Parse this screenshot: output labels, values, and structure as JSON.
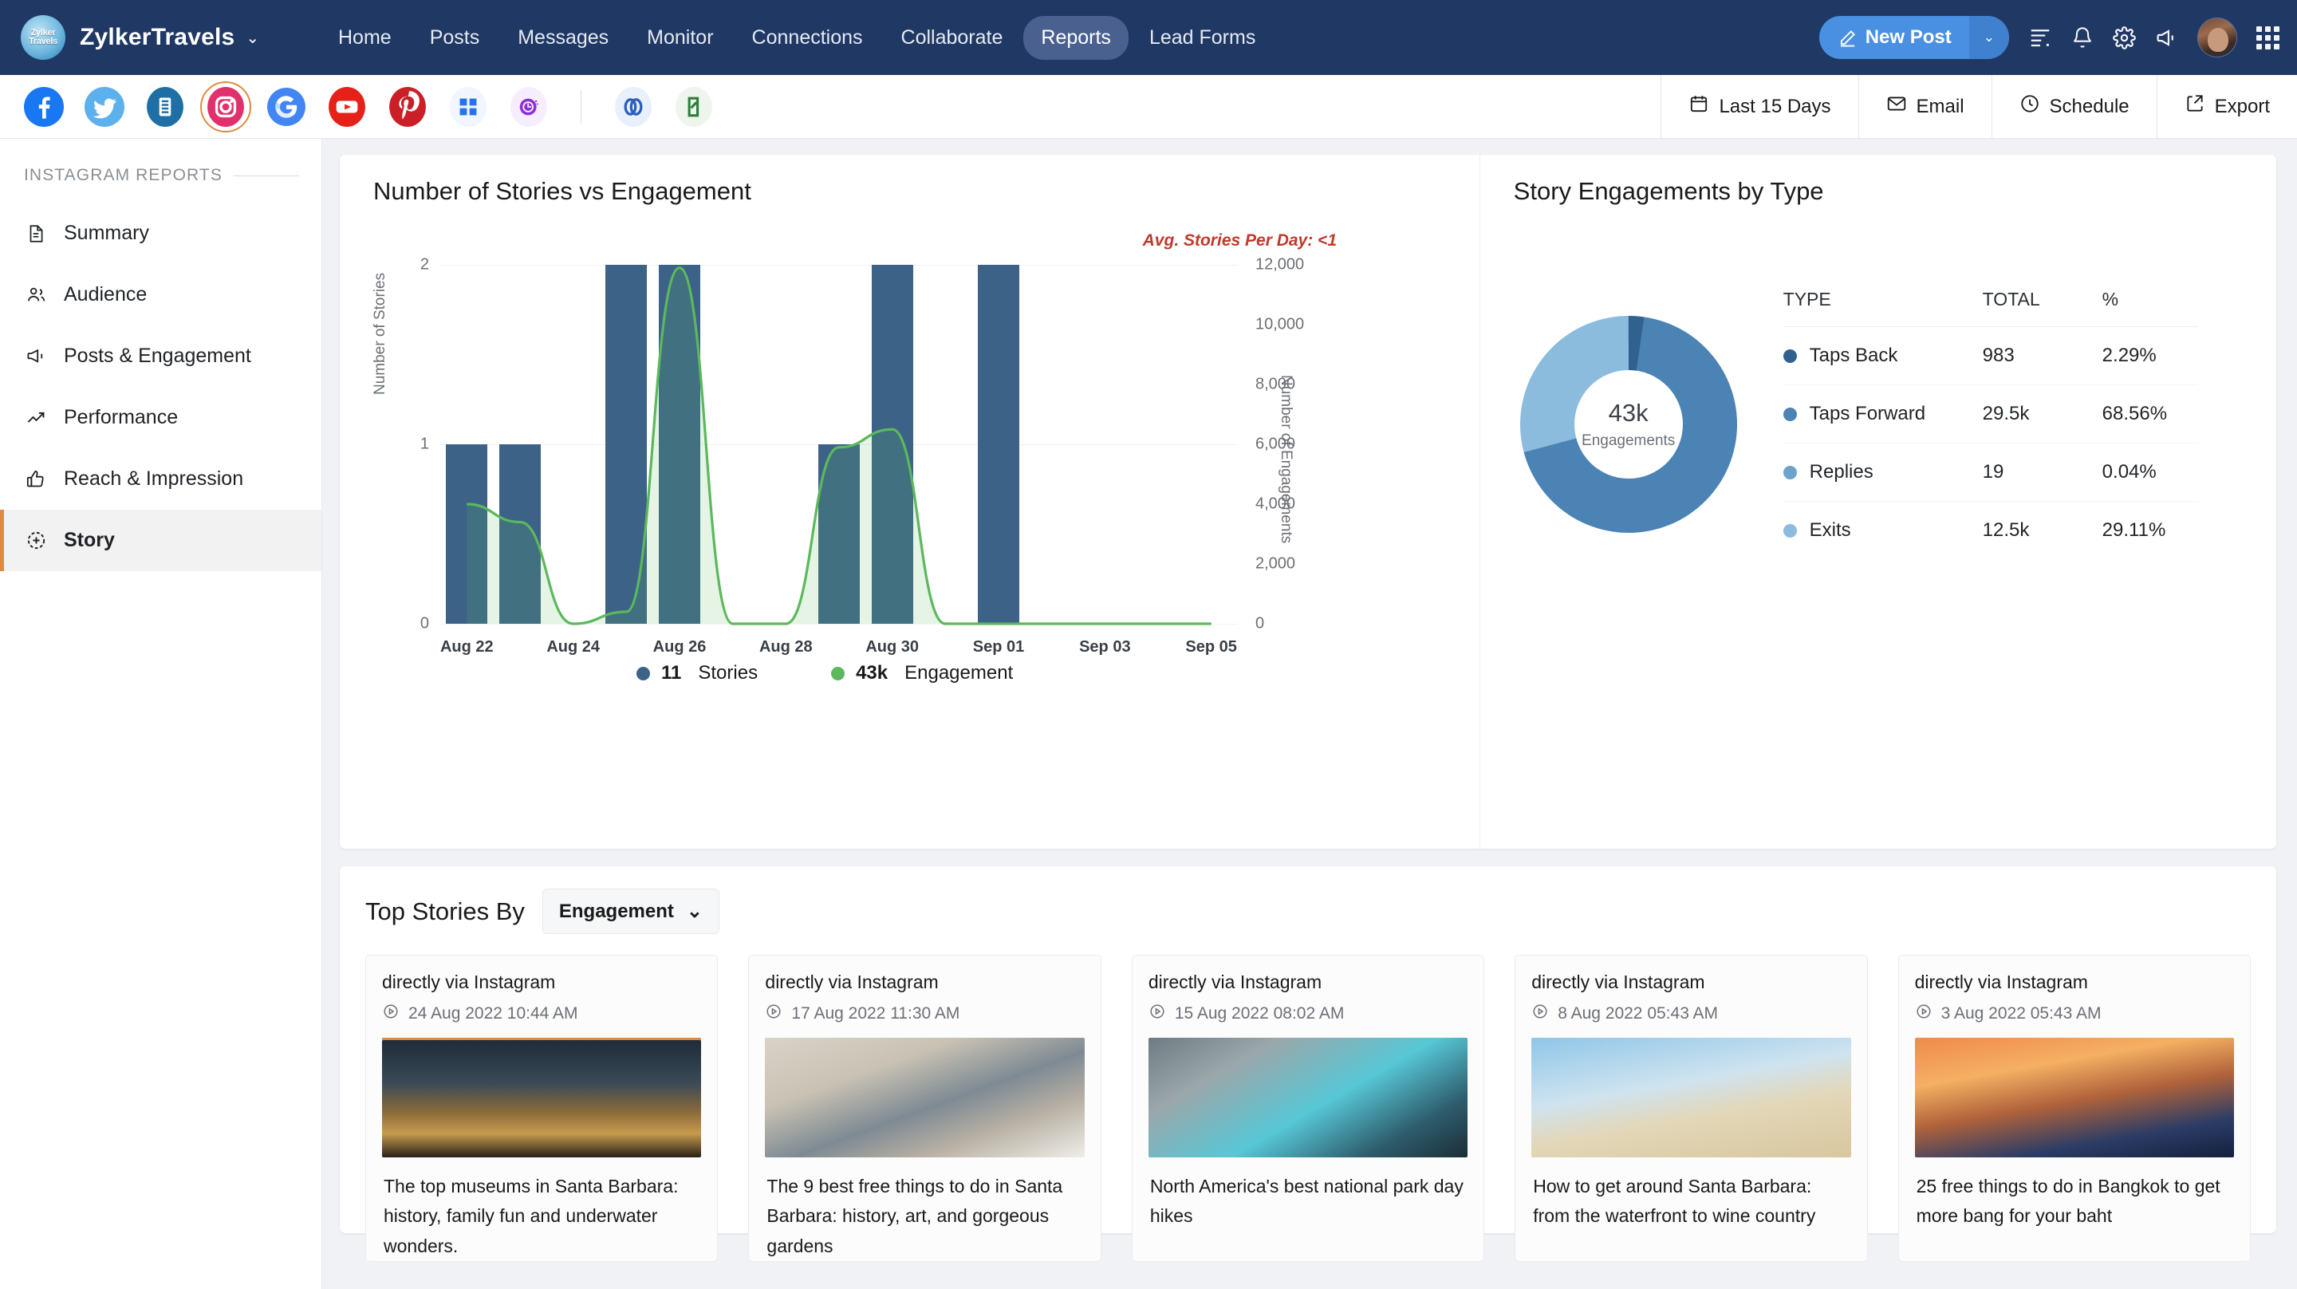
{
  "brand": {
    "logo_line1": "Zylker",
    "logo_line2": "Travels",
    "name": "ZylkerTravels",
    "caret": "⌄"
  },
  "main_menu": [
    {
      "label": "Home",
      "active": false
    },
    {
      "label": "Posts",
      "active": false
    },
    {
      "label": "Messages",
      "active": false
    },
    {
      "label": "Monitor",
      "active": false
    },
    {
      "label": "Connections",
      "active": false
    },
    {
      "label": "Collaborate",
      "active": false
    },
    {
      "label": "Reports",
      "active": true
    },
    {
      "label": "Lead Forms",
      "active": false
    }
  ],
  "nav_right": {
    "new_post_label": "New Post",
    "new_post_caret": "⌄",
    "icons": [
      "list-icon",
      "bell-icon",
      "gear-icon",
      "megaphone-icon",
      "avatar",
      "apps-grid-icon"
    ]
  },
  "channels": [
    {
      "name": "facebook",
      "color": "#1877f2"
    },
    {
      "name": "twitter",
      "color": "#5cb0ec"
    },
    {
      "name": "linkedin",
      "color": "#1d6fa5"
    },
    {
      "name": "instagram",
      "color": "#e1306c",
      "selected": true
    },
    {
      "name": "google-business",
      "color": "#4285f4"
    },
    {
      "name": "youtube",
      "color": "#e62117"
    },
    {
      "name": "pinterest",
      "color": "#cb1f27"
    },
    {
      "name": "microsoft",
      "color": "#2672ec"
    },
    {
      "name": "tiktok",
      "color": "#8b2fd6"
    },
    {
      "name": "zoho-link",
      "color": "#2b5fbe"
    },
    {
      "name": "zoho-desk",
      "color": "#2f7d3b"
    }
  ],
  "tools": [
    {
      "label": "Last 15 Days",
      "icon": "calendar-icon"
    },
    {
      "label": "Email",
      "icon": "envelope-icon"
    },
    {
      "label": "Schedule",
      "icon": "clock-icon"
    },
    {
      "label": "Export",
      "icon": "export-icon"
    }
  ],
  "sidebar": {
    "heading": "INSTAGRAM REPORTS",
    "items": [
      {
        "label": "Summary",
        "icon": "document-icon",
        "active": false
      },
      {
        "label": "Audience",
        "icon": "users-icon",
        "active": false
      },
      {
        "label": "Posts & Engagement",
        "icon": "megaphone-icon",
        "active": false
      },
      {
        "label": "Performance",
        "icon": "trending-up-icon",
        "active": false
      },
      {
        "label": "Reach & Impression",
        "icon": "thumbs-up-icon",
        "active": false
      },
      {
        "label": "Story",
        "icon": "story-plus-icon",
        "active": true
      }
    ]
  },
  "chart_data": [
    {
      "type": "bar",
      "title": "Number of Stories vs Engagement",
      "annotation": "Avg. Stories Per Day: <1",
      "xlabel": "",
      "ylabel": "Number of Stories",
      "y2label": "Number of Engagements",
      "ylim": [
        0,
        2
      ],
      "y2lim": [
        0,
        12000
      ],
      "yticks": [
        "0",
        "1",
        "2"
      ],
      "y2ticks": [
        "0",
        "2,000",
        "4,000",
        "6,000",
        "8,000",
        "10,000",
        "12,000"
      ],
      "categories": [
        "Aug 22",
        "Aug 23",
        "Aug 24",
        "Aug 25",
        "Aug 26",
        "Aug 27",
        "Aug 28",
        "Aug 29",
        "Aug 30",
        "Aug 31",
        "Sep 01",
        "Sep 02",
        "Sep 03",
        "Sep 04",
        "Sep 05"
      ],
      "xtick_labels": [
        "Aug 22",
        "Aug 24",
        "Aug 26",
        "Aug 28",
        "Aug 30",
        "Sep 01",
        "Sep 03",
        "Sep 05"
      ],
      "series": [
        {
          "name": "Stories",
          "type": "bar",
          "axis": "left",
          "color": "#3c6288",
          "values": [
            1,
            1,
            0,
            2,
            2,
            0,
            0,
            1,
            2,
            0,
            2,
            0,
            0,
            0,
            0
          ]
        },
        {
          "name": "Engagement",
          "type": "area",
          "axis": "right",
          "color": "#5cb85c",
          "values": [
            4000,
            3400,
            0,
            400,
            11900,
            0,
            0,
            5900,
            6500,
            0,
            0,
            0,
            0,
            0,
            0
          ]
        }
      ],
      "legend": [
        {
          "label": "Stories",
          "value": "11",
          "color": "#3c6288"
        },
        {
          "label": "Engagement",
          "value": "43k",
          "color": "#5cb85c"
        }
      ],
      "grid": true,
      "legend_position": "bottom"
    },
    {
      "type": "pie",
      "title": "Story Engagements by Type",
      "center_value": "43k",
      "center_label": "Engagements",
      "columns": [
        "TYPE",
        "TOTAL",
        "%"
      ],
      "rows": [
        {
          "type": "Taps Back",
          "total": "983",
          "pct": "2.29%",
          "value": 2.29,
          "color": "#31628f"
        },
        {
          "type": "Taps Forward",
          "total": "29.5k",
          "pct": "68.56%",
          "value": 68.56,
          "color": "#4a83b4"
        },
        {
          "type": "Replies",
          "total": "19",
          "pct": "0.04%",
          "value": 0.04,
          "color": "#6ba3cd"
        },
        {
          "type": "Exits",
          "total": "12.5k",
          "pct": "29.11%",
          "value": 29.11,
          "color": "#8bbbdd"
        }
      ]
    }
  ],
  "top_stories": {
    "title": "Top Stories By",
    "sort_value": "Engagement",
    "sort_caret": "⌄",
    "cards": [
      {
        "source": "directly via Instagram",
        "date": "24 Aug 2022 10:44 AM",
        "caption": "The top museums in Santa Barbara: history, family fun and underwater wonders.",
        "thumb": "t1",
        "accent": true
      },
      {
        "source": "directly via Instagram",
        "date": "17 Aug 2022 11:30 AM",
        "caption": "The 9 best free things to do in Santa Barbara: history, art, and gorgeous gardens",
        "thumb": "t2",
        "accent": false
      },
      {
        "source": "directly via Instagram",
        "date": "15 Aug 2022 08:02 AM",
        "caption": "North America's best national park day hikes",
        "thumb": "t3",
        "accent": false
      },
      {
        "source": "directly via Instagram",
        "date": "8 Aug 2022 05:43 AM",
        "caption": "How to get around Santa Barbara: from the waterfront to wine country",
        "thumb": "t4",
        "accent": false
      },
      {
        "source": "directly via Instagram",
        "date": "3 Aug 2022 05:43 AM",
        "caption": "25 free things to do in Bangkok to get more bang for your baht",
        "thumb": "t5",
        "accent": false
      }
    ]
  },
  "colors": {
    "nav": "#1f3864",
    "accent": "#e08a3c",
    "primary": "#4a90e2",
    "bar": "#3c6288",
    "line": "#5cb85c",
    "warning": "#c0392b"
  }
}
